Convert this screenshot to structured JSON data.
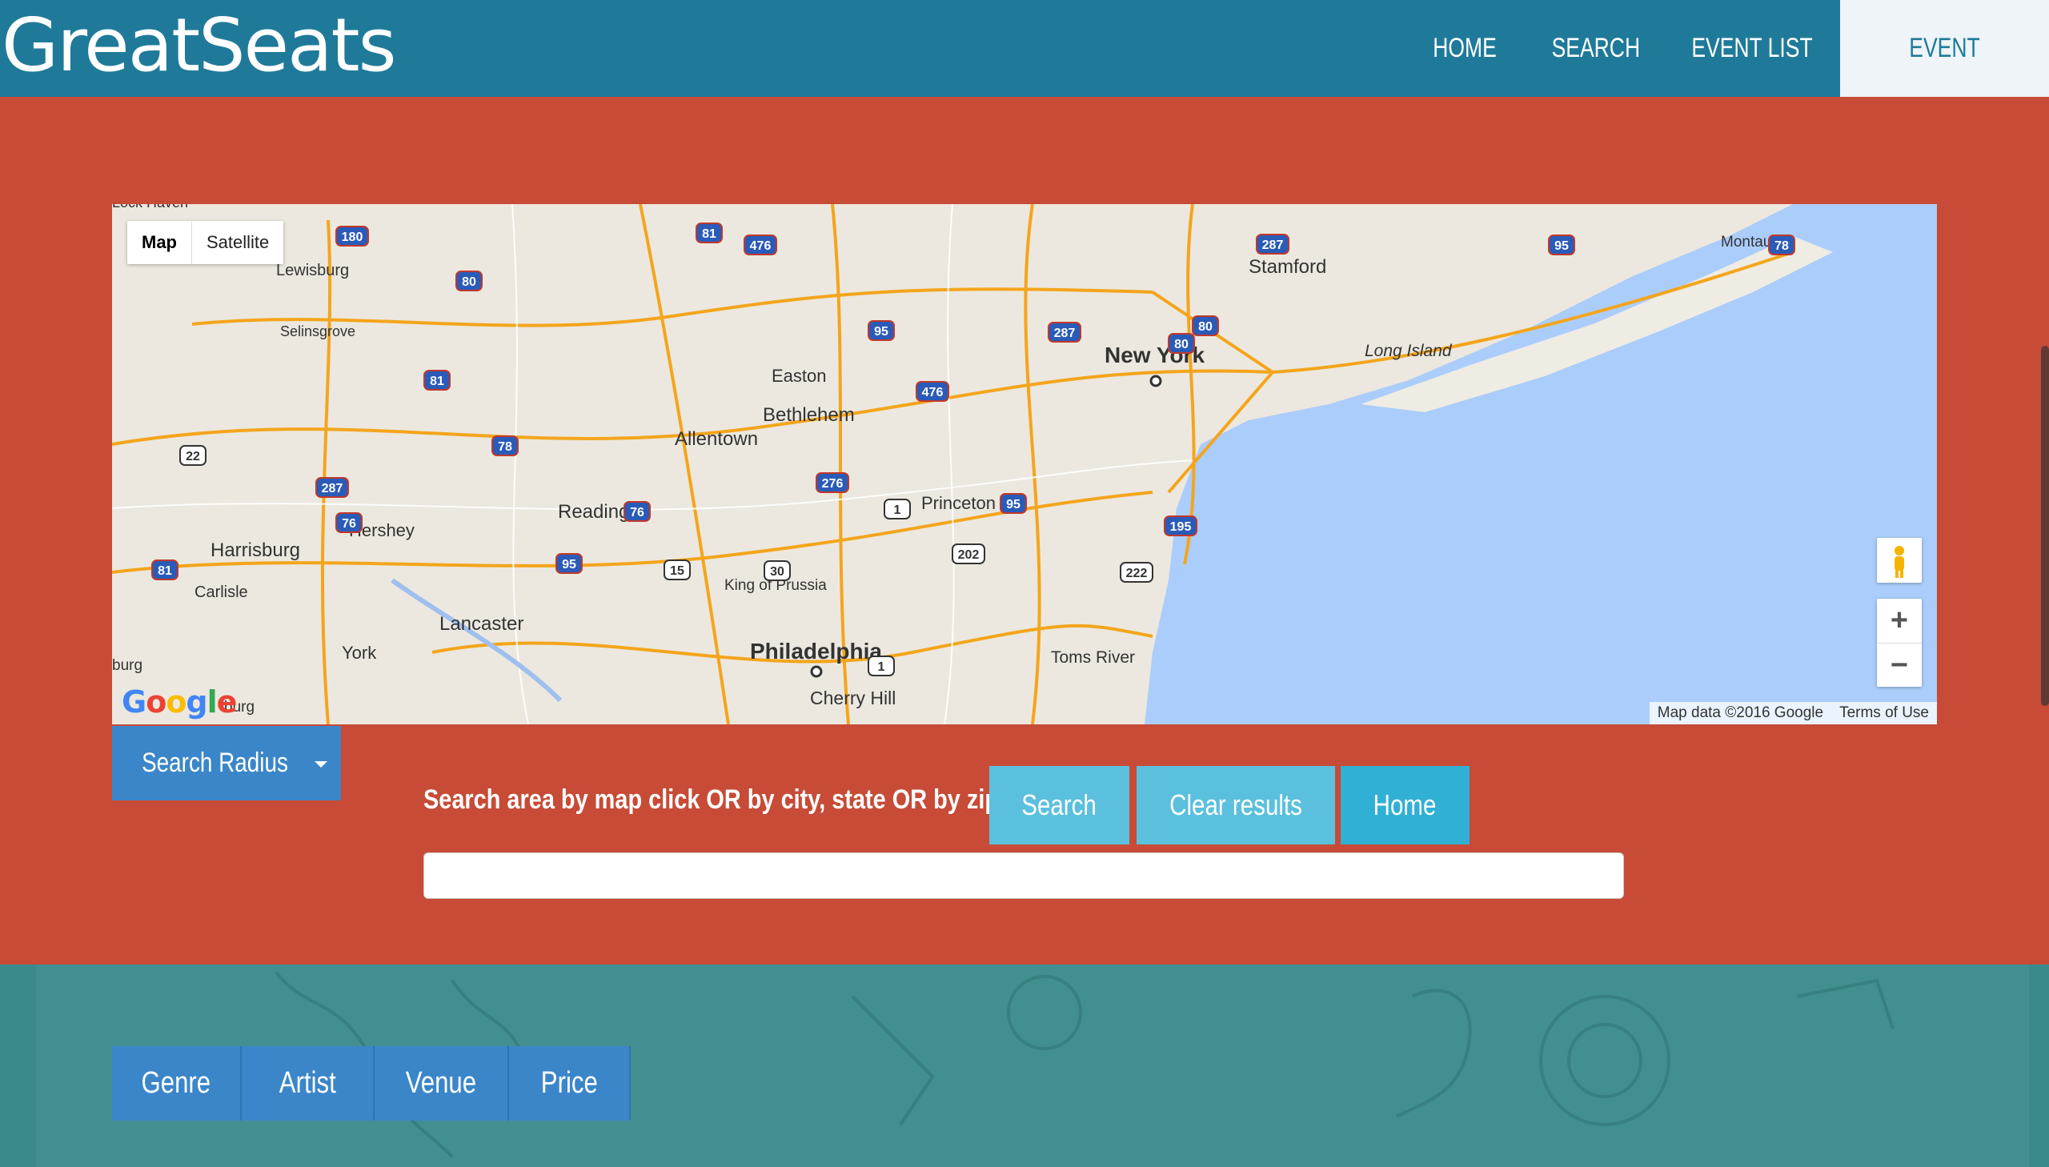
{
  "app": {
    "brand": "GreatSeats"
  },
  "nav": {
    "items": [
      {
        "label": "HOME",
        "active": false
      },
      {
        "label": "SEARCH",
        "active": false
      },
      {
        "label": "EVENT LIST",
        "active": false
      },
      {
        "label": "EVENT DETAILS",
        "active": true
      }
    ]
  },
  "map": {
    "type_toggle": {
      "map": "Map",
      "satellite": "Satellite",
      "selected": "Map"
    },
    "zoom_in": "+",
    "zoom_out": "−",
    "attribution": {
      "data": "Map data ©2016 Google",
      "terms": "Terms of Use"
    },
    "logo": "Google",
    "places": [
      "Lock Haven",
      "Lewisburg",
      "Selinsgrove",
      "Stamford",
      "Montauk",
      "New York",
      "Long Island",
      "Easton",
      "Bethlehem",
      "Allentown",
      "Princeton",
      "Reading",
      "Hershey",
      "Harrisburg",
      "Carlisle",
      "King of Prussia",
      "Lancaster",
      "York",
      "Philadelphia",
      "Cherry Hill",
      "Toms River",
      "burg",
      "burg"
    ],
    "route_shields": [
      "180",
      "81",
      "476",
      "80",
      "287",
      "95",
      "80",
      "287",
      "80",
      "95",
      "81",
      "22",
      "78",
      "476",
      "78",
      "287",
      "95",
      "76",
      "222",
      "276",
      "95",
      "1",
      "195",
      "81",
      "76",
      "30",
      "202",
      "15",
      "1"
    ]
  },
  "search": {
    "radius_label": "Search Radius",
    "prompt": "Search area by map click OR by city, state OR by zip",
    "input_value": "",
    "buttons": {
      "search": "Search",
      "clear": "Clear results",
      "home": "Home"
    }
  },
  "tabs": [
    "Genre",
    "Artist",
    "Venue",
    "Price"
  ],
  "colors": {
    "header": "#1f7a9a",
    "band": "#c74b36",
    "button_primary": "#3b86c9",
    "button_info": "#5bc0de",
    "teal": "#3a8a8c"
  }
}
